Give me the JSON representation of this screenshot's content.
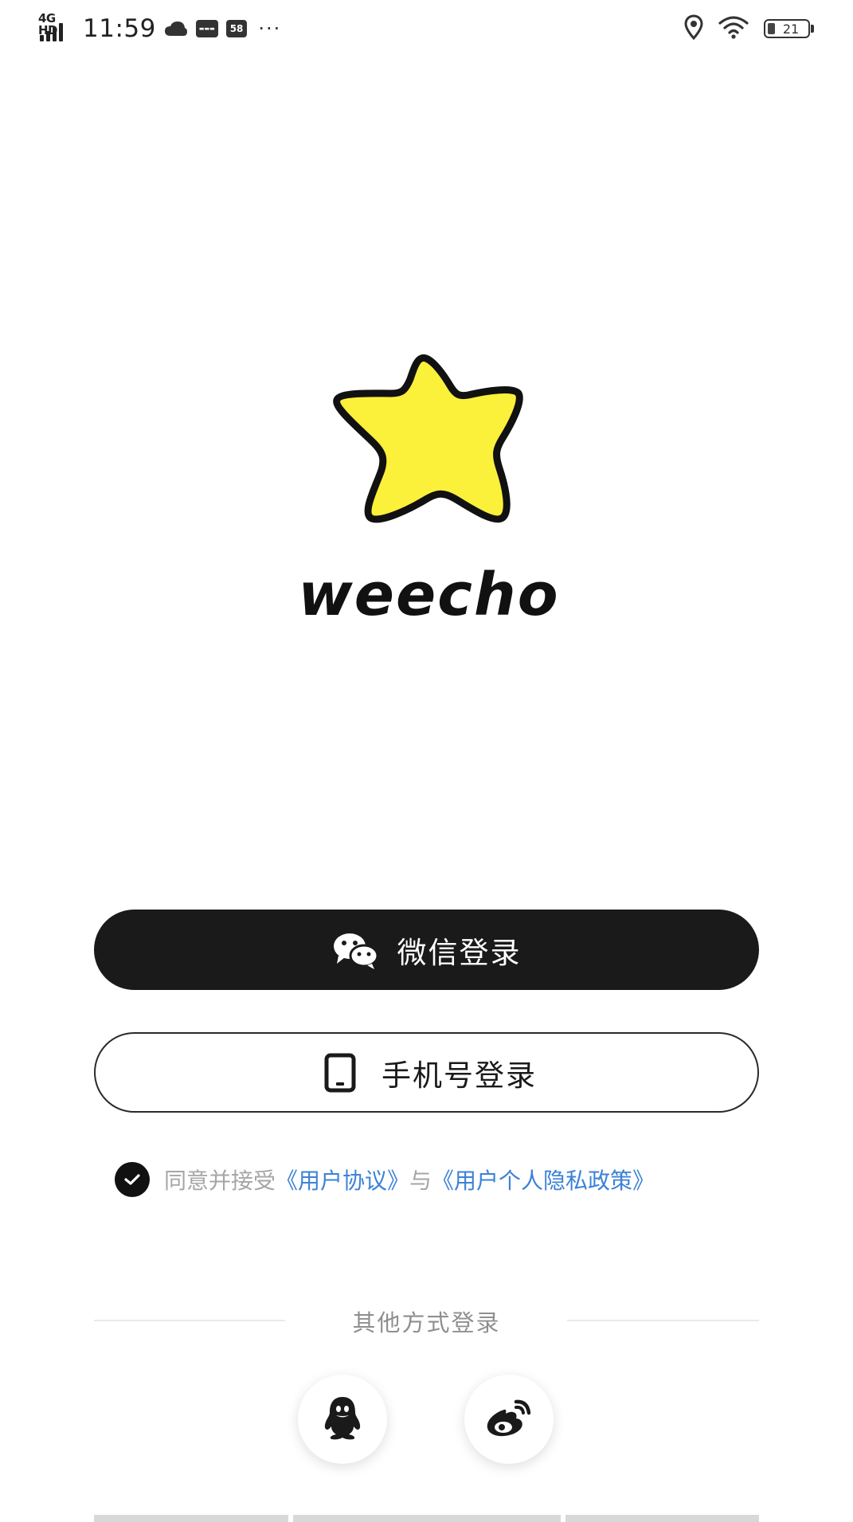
{
  "status_bar": {
    "network": "4G HD",
    "time": "11:59",
    "notification_badge": "58",
    "battery": "21",
    "icons": [
      "signal-icon",
      "cloud-icon",
      "app-notification-icon",
      "app-58-icon",
      "more-dots-icon",
      "location-icon",
      "wifi-icon",
      "battery-icon"
    ]
  },
  "logo": {
    "icon": "star-logo",
    "text": "weecho",
    "star_fill": "#fbf03a",
    "star_stroke": "#111111"
  },
  "buttons": {
    "wechat_login": "微信登录",
    "wechat_icon": "wechat-icon",
    "phone_login": "手机号登录",
    "phone_icon": "phone-icon"
  },
  "agreement": {
    "prefix": "同意并接受",
    "user_agreement": "《用户协议》",
    "connector": "与",
    "privacy_policy": "《用户个人隐私政策》",
    "checked": true
  },
  "other_login": {
    "title": "其他方式登录",
    "options": [
      {
        "icon": "qq-icon"
      },
      {
        "icon": "weibo-icon"
      }
    ]
  },
  "colors": {
    "primary_button": "#1a1a1a",
    "link": "#3c82d6",
    "muted_text": "#a6a6a6"
  }
}
